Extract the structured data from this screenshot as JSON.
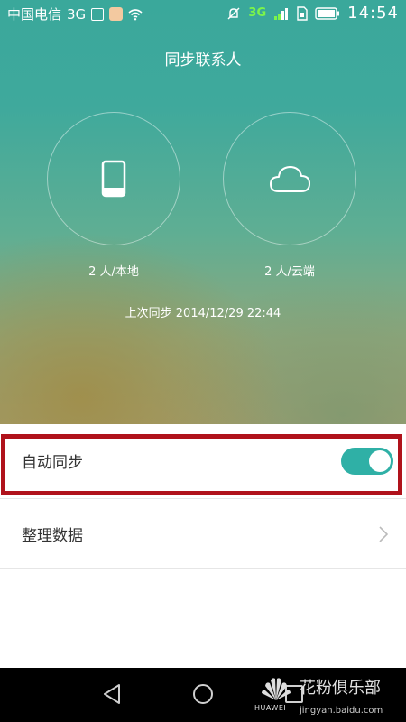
{
  "status_bar": {
    "carrier": "中国电信",
    "network_left": "3G",
    "network_green": "3G",
    "time": "14:54"
  },
  "header": {
    "title": "同步联系人"
  },
  "sync": {
    "local_count": "2 人/本地",
    "cloud_count": "2 人/云端",
    "last_sync": "上次同步 2014/12/29 22:44"
  },
  "settings": {
    "auto_sync_label": "自动同步",
    "auto_sync_on": true,
    "organize_label": "整理数据"
  },
  "watermark": {
    "brand": "HUAWEI",
    "text": "花粉俱乐部",
    "url": "jingyan.baidu.com"
  },
  "colors": {
    "toggle_on": "#2fb0a6",
    "highlight": "#b0121b",
    "hero_top": "#3aa89b",
    "hero_bottom": "#a3a072"
  },
  "icons": [
    "phone-icon",
    "cloud-icon",
    "chevron-right-icon",
    "back-icon",
    "home-icon",
    "recent-apps-icon",
    "wifi-icon",
    "battery-icon",
    "mute-icon",
    "signal-icon"
  ]
}
